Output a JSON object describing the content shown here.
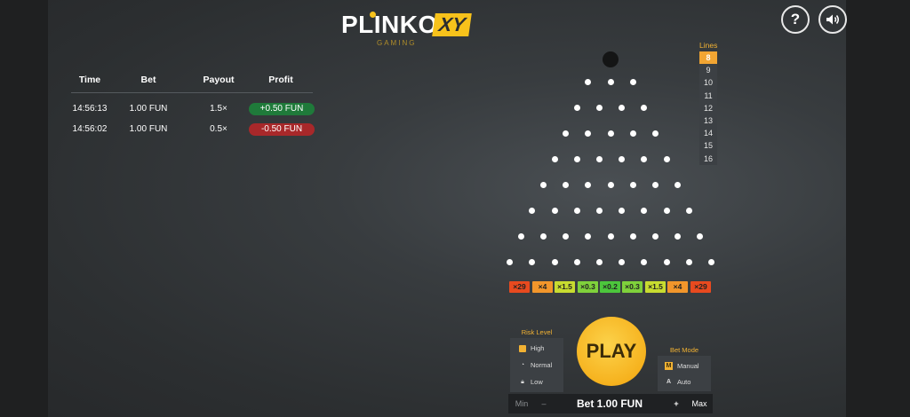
{
  "logo": {
    "main": "PLINKO",
    "badge": "XY",
    "sub": "GAMING"
  },
  "buttons": {
    "help": "?",
    "sound": "sound-icon"
  },
  "history": {
    "headers": {
      "time": "Time",
      "bet": "Bet",
      "payout": "Payout",
      "profit": "Profit"
    },
    "rows": [
      {
        "time": "14:56:13",
        "bet": "1.00 FUN",
        "payout": "1.5×",
        "profit": "+0.50 FUN",
        "positive": true
      },
      {
        "time": "14:56:02",
        "bet": "1.00 FUN",
        "payout": "0.5×",
        "profit": "-0.50 FUN",
        "positive": false
      }
    ]
  },
  "lines": {
    "title": "Lines",
    "options": [
      "8",
      "9",
      "10",
      "11",
      "12",
      "13",
      "14",
      "15",
      "16"
    ],
    "selected": "8"
  },
  "multipliers": [
    {
      "label": "×29",
      "color": "#e84a1f"
    },
    {
      "label": "×4",
      "color": "#f2962b"
    },
    {
      "label": "×1.5",
      "color": "#c8dc30"
    },
    {
      "label": "×0.3",
      "color": "#7fd13b"
    },
    {
      "label": "×0.2",
      "color": "#4cc63c"
    },
    {
      "label": "×0.3",
      "color": "#7fd13b"
    },
    {
      "label": "×1.5",
      "color": "#c8dc30"
    },
    {
      "label": "×4",
      "color": "#f2962b"
    },
    {
      "label": "×29",
      "color": "#e84a1f"
    }
  ],
  "risk": {
    "title": "Risk Level",
    "items": [
      {
        "label": "High",
        "icon": "check-icon",
        "selected": true
      },
      {
        "label": "Normal",
        "icon": "gauge-icon",
        "selected": false
      },
      {
        "label": "Low",
        "icon": "lock-icon",
        "selected": false
      }
    ]
  },
  "play": {
    "label": "PLAY"
  },
  "mode": {
    "title": "Bet Mode",
    "items": [
      {
        "label": "Manual",
        "glyph": "M",
        "selected": true
      },
      {
        "label": "Auto",
        "glyph": "A",
        "selected": false
      }
    ]
  },
  "bet": {
    "min": "Min",
    "minus": "–",
    "value": "Bet 1.00 FUN",
    "plus": "+",
    "max": "Max"
  },
  "colors": {
    "accent": "#f2b233",
    "play": "#f6b21e"
  }
}
